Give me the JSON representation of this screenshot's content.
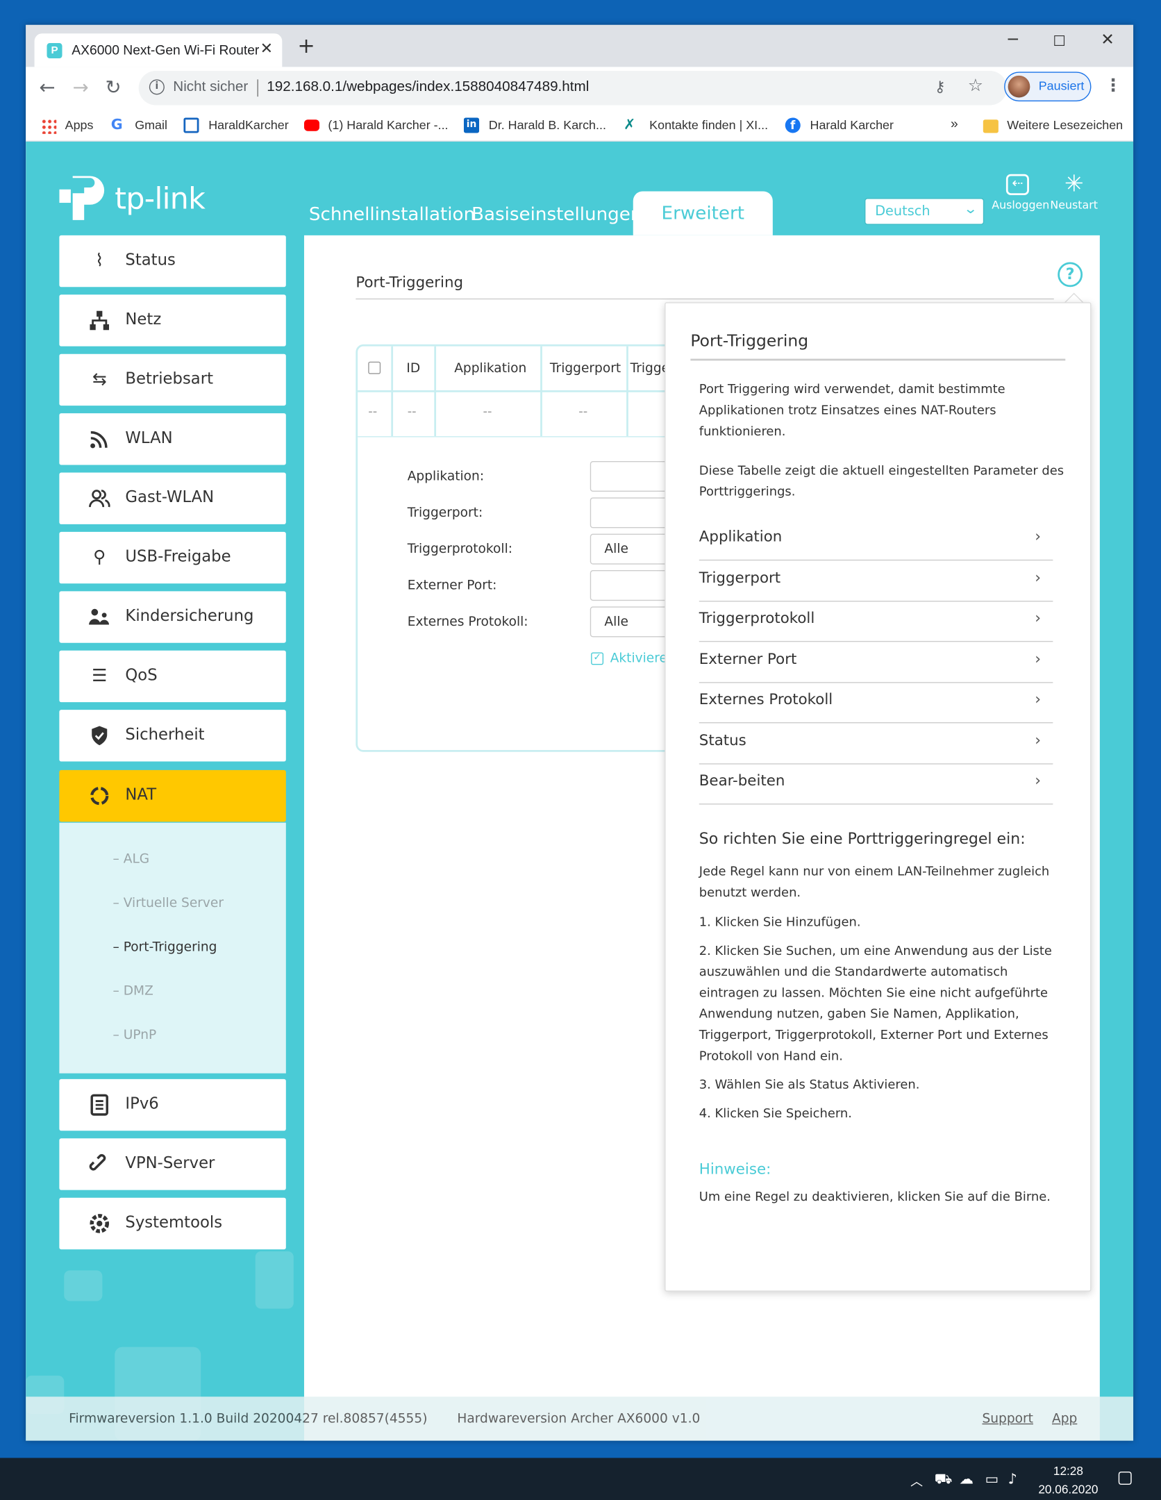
{
  "browser": {
    "tab_title": "AX6000 Next-Gen Wi-Fi Router",
    "new_tab": "+",
    "security": "Nicht sicher",
    "url": "192.168.0.1/webpages/index.1588040847489.html",
    "profile_label": "Pausiert",
    "bookmarks": [
      "Apps",
      "Gmail",
      "HaraldKarcher",
      "(1) Harald Karcher -...",
      "Dr. Harald B. Karch...",
      "Kontakte finden | XI...",
      "Harald Karcher"
    ],
    "bookmarks_more": "»",
    "bookmarks_folder": "Weitere Lesezeichen"
  },
  "router": {
    "logo": "tp-link",
    "nav": [
      "Schnellinstallation",
      "Basiseinstellungen",
      "Erweitert"
    ],
    "language": "Deutsch",
    "logout_label": "Ausloggen",
    "reboot_label": "Neustart",
    "sidebar": [
      {
        "label": "Status"
      },
      {
        "label": "Netz"
      },
      {
        "label": "Betriebsart"
      },
      {
        "label": "WLAN"
      },
      {
        "label": "Gast-WLAN"
      },
      {
        "label": "USB-Freigabe"
      },
      {
        "label": "Kindersicherung"
      },
      {
        "label": "QoS"
      },
      {
        "label": "Sicherheit"
      },
      {
        "label": "NAT"
      },
      {
        "label": "IPv6"
      },
      {
        "label": "VPN-Server"
      },
      {
        "label": "Systemtools"
      }
    ],
    "submenu": [
      "ALG",
      "Virtuelle Server",
      "Port-Triggering",
      "DMZ",
      "UPnP"
    ],
    "submenu_prefix": "–",
    "section_title": "Port-Triggering",
    "table": {
      "headers": [
        "ID",
        "Applikation",
        "Triggerport",
        "Trigge"
      ],
      "empty_cell": "--"
    },
    "form": {
      "labels": [
        "Applikation:",
        "Triggerport:",
        "Triggerprotokoll:",
        "Externer Port:",
        "Externes Protokoll:"
      ],
      "trigger_protocol_value": "Alle",
      "external_protocol_value": "Alle",
      "enable_label": "Aktiviere"
    },
    "help": {
      "title": "Port-Triggering",
      "intro1": "Port Triggering wird verwendet, damit bestimmte Applikationen trotz Einsatzes eines NAT-Routers funktionieren.",
      "intro2": "Diese Tabelle zeigt die aktuell eingestellten Parameter des Porttriggerings.",
      "items": [
        "Applikation",
        "Triggerport",
        "Triggerprotokoll",
        "Externer Port",
        "Externes Protokoll",
        "Status",
        "Bear-beiten"
      ],
      "howto_title": "So richten Sie eine Porttriggeringregel ein:",
      "howto_intro": "Jede Regel kann nur von einem LAN-Teilnehmer zugleich benutzt werden.",
      "steps": [
        "1. Klicken Sie Hinzufügen.",
        "2. Klicken Sie Suchen, um eine Anwendung aus der Liste auszuwählen und die Standardwerte automatisch eintragen zu lassen. Möchten Sie eine nicht aufgeführte Anwendung nutzen, gaben Sie Namen, Applikation, Triggerport, Triggerprotokoll, Externer Port und Externes Protokoll von Hand ein.",
        "3. Wählen Sie als Status Aktivieren.",
        "4. Klicken Sie Speichern."
      ],
      "notes_title": "Hinweise:",
      "notes_text": "Um eine Regel zu deaktivieren, klicken Sie auf die Birne."
    },
    "footer": {
      "firmware": "Firmwareversion 1.1.0 Build 20200427 rel.80857(4555)",
      "hardware": "Hardwareversion Archer AX6000 v1.0",
      "support": "Support",
      "app": "App"
    }
  },
  "taskbar": {
    "time": "12:28",
    "date": "20.06.2020"
  },
  "colors": {
    "accent": "#4acbd6",
    "active_menu": "#ffc800",
    "desktop": "#0d63b5"
  }
}
